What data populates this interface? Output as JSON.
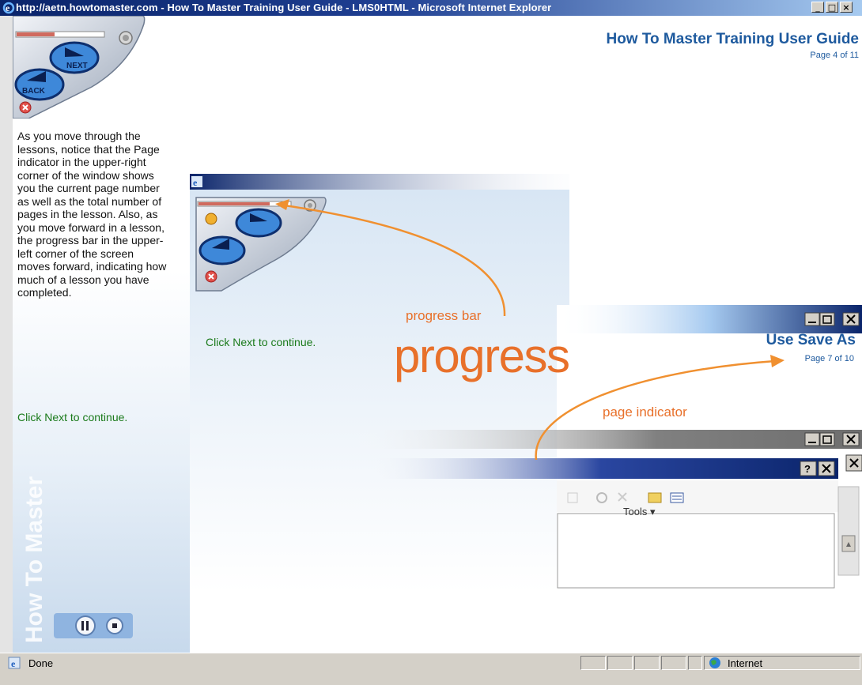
{
  "window": {
    "title": "http://aetn.howtomaster.com - How To Master Training User Guide - LMS0HTML - Microsoft Internet Explorer",
    "minimize_glyph": "_",
    "maximize_glyph": "□",
    "close_glyph": "×"
  },
  "header": {
    "title": "How To Master Training User Guide",
    "page_indicator": "Page 4 of 11"
  },
  "nav": {
    "next_label": "NEXT",
    "back_label": "BACK"
  },
  "lesson": {
    "body": "As you move through the lessons, notice that the Page indicator in the upper-right corner of the window shows you the current page number as well as the total number of pages in the lesson. Also, as you move forward in a lesson, the progress bar in the upper-left corner of the screen moves forward, indicating how much of a lesson you have completed.",
    "next_instruction": "Click Next to continue."
  },
  "watermark": "How To Master",
  "demo": {
    "next_instruction": "Click Next to continue.",
    "headline": "progress",
    "label_progress_bar": "progress bar",
    "label_page_indicator": "page indicator",
    "save_title": "Use Save As",
    "save_page_indicator": "Page 7 of 10",
    "dialog_help_glyph": "?",
    "tools_label": "Tools"
  },
  "statusbar": {
    "status_text": "Done",
    "zone_text": "Internet"
  },
  "colors": {
    "title_bar": "#0a246a",
    "accent_blue": "#1e5a9e",
    "accent_orange": "#e8702a",
    "green_text": "#1a7a1a"
  }
}
